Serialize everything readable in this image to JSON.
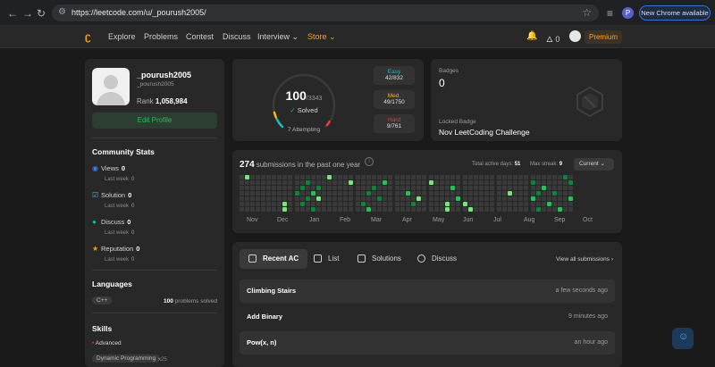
{
  "browser": {
    "url": "https://leetcode.com/u/_pourush2005/",
    "new_chrome_label": "New Chrome available",
    "profile_initial": "P"
  },
  "nav": {
    "items": [
      "Explore",
      "Problems",
      "Contest",
      "Discuss",
      "Interview ⌄"
    ],
    "store_label": "Store ⌄",
    "streak_count": "0",
    "premium_label": "Premium"
  },
  "profile": {
    "username": "_pourush2005",
    "handle": "_pourush2005",
    "rank_label": "Rank",
    "rank_value": "1,058,984",
    "edit_label": "Edit Profile"
  },
  "community": {
    "title": "Community Stats",
    "last_week_label": "Last week",
    "items": [
      {
        "label": "Views",
        "value": "0",
        "last_week": "0",
        "color": "#3b82f6"
      },
      {
        "label": "Solution",
        "value": "0",
        "last_week": "0",
        "color": "#38bdf8"
      },
      {
        "label": "Discuss",
        "value": "0",
        "last_week": "0",
        "color": "#14b8a6"
      },
      {
        "label": "Reputation",
        "value": "0",
        "last_week": "0",
        "color": "#f59e0b"
      }
    ]
  },
  "languages": {
    "title": "Languages",
    "language": "C++",
    "solved_count": "100",
    "solved_label": "problems solved"
  },
  "skills": {
    "title": "Skills",
    "level": "Advanced",
    "chip": "Dynamic Programming",
    "chip_count": "x25"
  },
  "solved": {
    "count": "100",
    "total": "/3343",
    "label": "Solved",
    "attempting": "7 Attempting",
    "fraction": 0.03,
    "easy": {
      "label": "Easy",
      "value": "42/832",
      "color": "#1cbaba"
    },
    "med": {
      "label": "Med.",
      "value": "49/1750",
      "color": "#ffb700"
    },
    "hard": {
      "label": "Hard",
      "value": "9/761",
      "color": "#f63737"
    }
  },
  "badges": {
    "title": "Badges",
    "count": "0",
    "locked_title": "Locked Badge",
    "locked_name": "Nov LeetCoding Challenge"
  },
  "submissions": {
    "count": "274",
    "label": "submissions in the past one year",
    "active_days_label": "Total active days:",
    "active_days": "51",
    "max_streak_label": "Max streak:",
    "max_streak": "9",
    "period": "Current",
    "months": [
      "Nov",
      "Dec",
      "Jan",
      "Feb",
      "Mar",
      "Apr",
      "May",
      "Jun",
      "Jul",
      "Aug",
      "Sep",
      "Oct"
    ]
  },
  "recent": {
    "tabs": [
      "Recent AC",
      "List",
      "Solutions",
      "Discuss"
    ],
    "view_all": "View all submissions ›",
    "rows": [
      {
        "name": "Climbing Stairs",
        "time": "a few seconds ago"
      },
      {
        "name": "Add Binary",
        "time": "9 minutes ago"
      },
      {
        "name": "Pow(x, n)",
        "time": "an hour ago"
      }
    ]
  }
}
